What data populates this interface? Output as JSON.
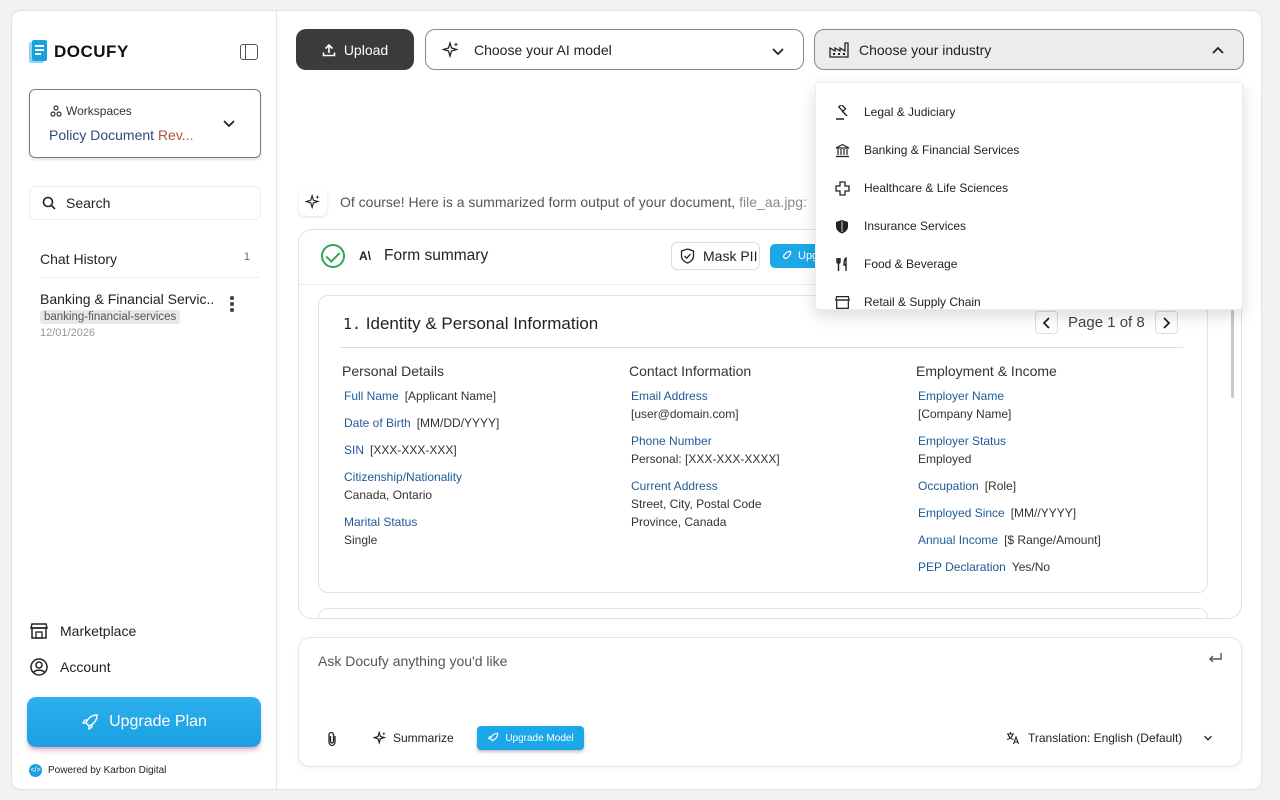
{
  "brand": {
    "name": "DOCUFY",
    "accent": "#1a9fe0"
  },
  "sidebar": {
    "workspace_label": "Workspaces",
    "workspace_value_a": "Policy Document ",
    "workspace_value_b": "Rev...",
    "search_label": "Search",
    "chat_history_label": "Chat History",
    "chat_history_count": "1",
    "history": [
      {
        "title": "Banking & Financial Servic..",
        "tag": "banking-financial-services",
        "date": "12/01/2026"
      }
    ],
    "marketplace_label": "Marketplace",
    "account_label": "Account",
    "upgrade_label": "Upgrade Plan",
    "powered_by": "Powered by Karbon Digital"
  },
  "toolbar": {
    "upload_label": "Upload",
    "model_placeholder": "Choose your AI model",
    "industry_placeholder": "Choose your industry"
  },
  "industry_menu": {
    "items": [
      {
        "label": "Legal & Judiciary",
        "icon": "gavel-icon"
      },
      {
        "label": "Banking & Financial Services",
        "icon": "bank-icon"
      },
      {
        "label": "Healthcare & Life Sciences",
        "icon": "medical-cross-icon"
      },
      {
        "label": "Insurance Services",
        "icon": "shield-icon"
      },
      {
        "label": "Food & Beverage",
        "icon": "fork-knife-icon"
      },
      {
        "label": "Retail & Supply Chain",
        "icon": "store-icon"
      }
    ]
  },
  "message": {
    "text": "Of course! Here is a summarized form output of your document, ",
    "file": "file_aa.jpg:"
  },
  "form": {
    "title": "Form summary",
    "mask_label": "Mask PII",
    "upgrade_short": "Upg",
    "section_number": "1.",
    "section_title": "Identity & Personal Information",
    "pager": "Page 1 of 8",
    "columns": [
      {
        "heading": "Personal Details",
        "fields": [
          {
            "key": "Full Name",
            "value": "[Applicant Name]",
            "block": false
          },
          {
            "key": "Date of Birth",
            "value": "[MM/DD/YYYY]",
            "block": false
          },
          {
            "key": "SIN",
            "value": "[XXX-XXX-XXX]",
            "block": false
          },
          {
            "key": "Citizenship/Nationality",
            "value": "Canada, Ontario",
            "block": true
          },
          {
            "key": "Marital Status",
            "value": "Single",
            "block": true
          }
        ]
      },
      {
        "heading": "Contact Information",
        "fields": [
          {
            "key": "Email Address",
            "value": "[user@domain.com]",
            "block": true
          },
          {
            "key": "Phone Number",
            "value": "Personal: [XXX-XXX-XXXX]",
            "block": true
          },
          {
            "key": "Current Address",
            "value": "Street, City, Postal Code",
            "value2": "Province, Canada",
            "block": true
          }
        ]
      },
      {
        "heading": "Employment & Income",
        "fields": [
          {
            "key": "Employer Name",
            "value": "[Company Name]",
            "block": true
          },
          {
            "key": "Employer Status",
            "value": "Employed",
            "block": true
          },
          {
            "key": "Occupation",
            "value": "[Role]",
            "block": false
          },
          {
            "key": "Employed Since",
            "value": "[MM//YYYY]",
            "block": false
          },
          {
            "key": "Annual Income",
            "value": "[$ Range/Amount]",
            "block": false
          },
          {
            "key": "PEP Declaration",
            "value": "Yes/No",
            "block": false
          }
        ]
      }
    ]
  },
  "composer": {
    "placeholder": "Ask Docufy anything you'd like",
    "summarize_label": "Summarize",
    "upgrade_model_label": "Upgrade Model",
    "translation_label": "Translation: English (Default)"
  }
}
